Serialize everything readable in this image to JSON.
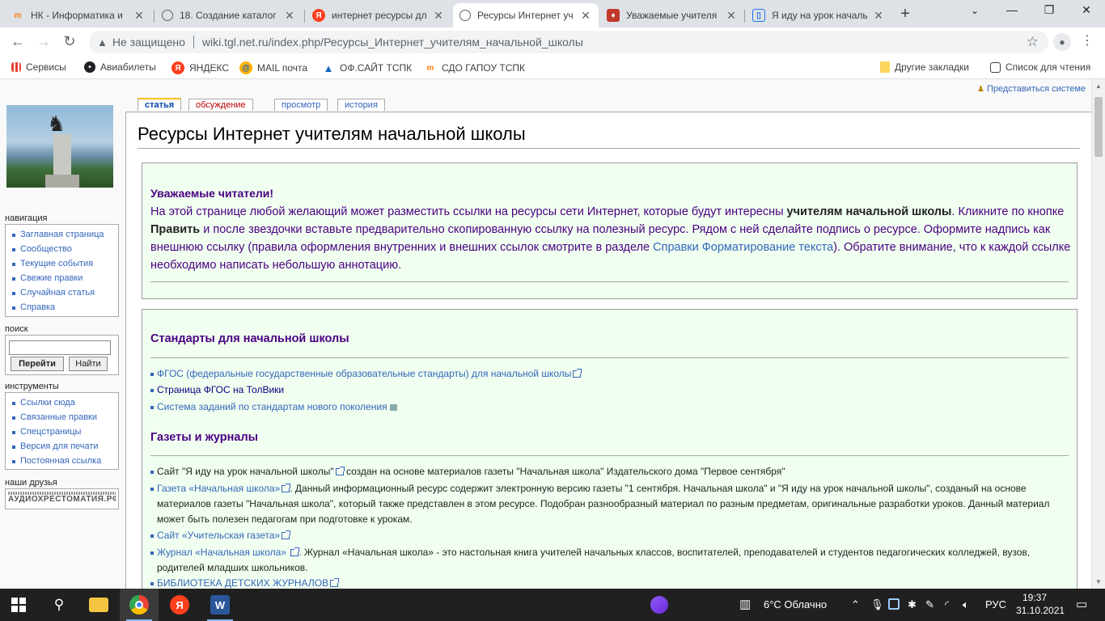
{
  "browser": {
    "tabs": [
      {
        "title": "НК - Информатика и",
        "favicon": "moodle-icon",
        "color": "#f98012"
      },
      {
        "title": "18. Создание каталог",
        "favicon": "globe-icon",
        "color": "#5f6368"
      },
      {
        "title": "интернет ресурсы дл",
        "favicon": "yandex-icon",
        "color": "#fc3f1d"
      },
      {
        "title": "Ресурсы Интернет уч",
        "favicon": "globe-icon",
        "color": "#5f6368",
        "active": true
      },
      {
        "title": "Уважаемые учителя",
        "favicon": "school-icon",
        "color": "#c0392b"
      },
      {
        "title": "Я иду на урок началь",
        "favicon": "book-icon",
        "color": "#1a73e8"
      }
    ],
    "address": {
      "security": "Не защищено",
      "url": "wiki.tgl.net.ru/index.php/Ресурсы_Интернет_учителям_начальной_школы"
    },
    "bookmarks": [
      {
        "label": "Сервисы",
        "icon": "apps-grid-icon"
      },
      {
        "label": "Авиабилеты",
        "icon": "globe-icon"
      },
      {
        "label": "ЯНДЕКС",
        "icon": "yandex-icon"
      },
      {
        "label": "MAIL почта",
        "icon": "mail-at-icon"
      },
      {
        "label": "ОФ.САЙТ ТСПК",
        "icon": "triangle-logo-icon"
      },
      {
        "label": "СДО ГАПОУ ТСПК",
        "icon": "moodle-icon"
      }
    ],
    "bookmarks_right": {
      "other": "Другие закладки",
      "reading_list": "Список для чтения"
    }
  },
  "wiki": {
    "login": "Представиться системе",
    "tabs": {
      "article": "статья",
      "discussion": "обсуждение",
      "view": "просмотр",
      "history": "история"
    },
    "nav_heading": "навигация",
    "nav_items": [
      "Заглавная страница",
      "Сообщество",
      "Текущие события",
      "Свежие правки",
      "Случайная статья",
      "Справка"
    ],
    "search_heading": "поиск",
    "search_go": "Перейти",
    "search_find": "Найти",
    "tools_heading": "инструменты",
    "tools_items": [
      "Ссылки сюда",
      "Связанные правки",
      "Спецстраницы",
      "Версия для печати",
      "Постоянная ссылка"
    ],
    "friends_heading": "наши друзья",
    "friends_banner": "АУДИОХРЕСТОМАТИЯ.РФ",
    "title": "Ресурсы Интернет учителям начальной школы",
    "intro": {
      "heading": "Уважаемые читатели!",
      "p1": "На этой странице любой желающий может разместить ссылки на ресурсы сети Интернет, которые будут интересны ",
      "b1": "учителям начальной школы",
      "p2": ". Кликните по кнопке ",
      "b2": "Править",
      "p3": " и после звездочки вставьте предварительно скопированную ссылку на полезный ресурс. Рядом с ней сделайте подпись о ресурсе. Оформите надпись как внешнюю ссылку (правила оформления внутренних и внешних ссылок смотрите в разделе ",
      "link": "Справки Форматирование текста",
      "p4": "). Обратите внимание, что к каждой ссылке необходимо написать небольшую аннотацию."
    },
    "sec1": {
      "heading": "Стандарты для начальной школы",
      "items": [
        "ФГОС (федеральные государственные образовательные стандарты) для начальной школы",
        "Страница ФГОС на ТолВики",
        "Система заданий по стандартам нового поколения"
      ]
    },
    "sec2": {
      "heading": "Газеты и журналы",
      "i1_link": "Сайт \"Я иду на урок начальной школы\"",
      "i1_text": " создан на основе материалов газеты \"Начальная школа\" Издательского дома \"Первое сентября\"",
      "i2_link": "Газета «Начальная школа»",
      "i2_text": ". Данный информационный ресурс содержит электронную версию газеты \"1 сентября. Начальная школа\" и \"Я иду на урок начальной школы\", созданый на основе материалов газеты \"Начальная школа\", который также представлен в этом ресурсе. Подобран разнообразный материал по разным предметам, оригинальные разработки уроков. Данный материал может быть полезен педагогам при подготовке к урокам.",
      "i3_link": "Сайт «Учительская газета»",
      "i4_link": "Журнал «Начальная школа»",
      "i4_text": ". Журнал «Начальная школа» - это настольная книга учителей начальных классов, воспитателей, преподавателей и студентов педагогических колледжей, вузов, родителей младших школьников.",
      "i5_link": "БИБЛИОТЕКА ДЕТСКИХ ЖУРНАЛОВ"
    }
  },
  "taskbar": {
    "weather": "6°C  Облачно",
    "lang": "РУС",
    "time": "19:37",
    "date": "31.10.2021"
  }
}
